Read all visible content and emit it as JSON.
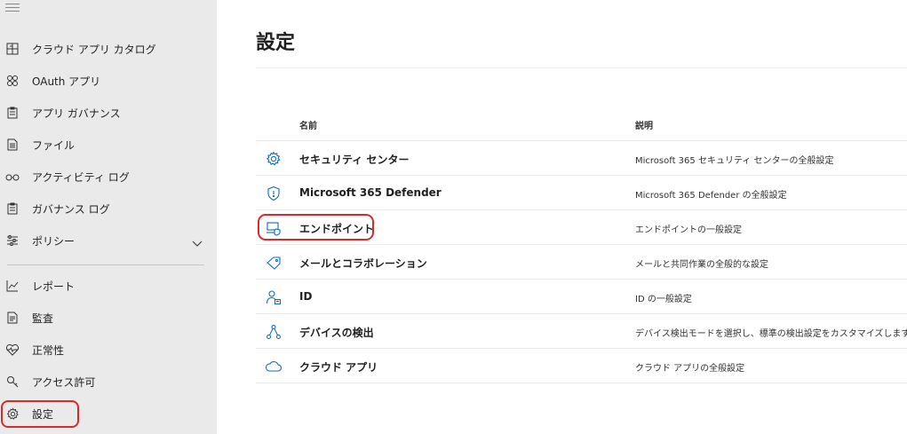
{
  "sidebar": {
    "items": [
      {
        "label": "クラウド アプリ カタログ",
        "icon": "catalog-icon"
      },
      {
        "label": "OAuth アプリ",
        "icon": "oauth-apps-icon"
      },
      {
        "label": "アプリ ガバナンス",
        "icon": "app-governance-icon"
      },
      {
        "label": "ファイル",
        "icon": "files-icon"
      },
      {
        "label": "アクティビティ ログ",
        "icon": "glasses-icon"
      },
      {
        "label": "ガバナンス ログ",
        "icon": "governance-log-icon"
      },
      {
        "label": "ポリシー",
        "icon": "policy-sliders-icon",
        "expandable": true
      },
      {
        "label": "レポート",
        "icon": "report-chart-icon"
      },
      {
        "label": "監査",
        "icon": "audit-icon"
      },
      {
        "label": "正常性",
        "icon": "health-heart-icon"
      },
      {
        "label": "アクセス許可",
        "icon": "key-icon"
      },
      {
        "label": "設定",
        "icon": "gear-icon",
        "highlighted": true
      }
    ]
  },
  "main": {
    "title": "設定",
    "table": {
      "headers": {
        "name": "名前",
        "description": "説明"
      },
      "rows": [
        {
          "name": "セキュリティ センター",
          "description": "Microsoft 365 セキュリティ センターの全般設定",
          "icon": "gear-icon"
        },
        {
          "name": "Microsoft 365 Defender",
          "description": "Microsoft 365 Defender の全般設定",
          "icon": "shield-icon"
        },
        {
          "name": "エンドポイント",
          "description": "エンドポイントの一般設定",
          "icon": "endpoint-device-icon",
          "highlighted": true
        },
        {
          "name": "メールとコラボレーション",
          "description": "メールと共同作業の全般的な設定",
          "icon": "mail-tag-icon"
        },
        {
          "name": "ID",
          "description": "ID の一般設定",
          "icon": "identity-person-icon"
        },
        {
          "name": "デバイスの検出",
          "description": "デバイス検出モードを選択し、標準の検出設定をカスタマイズします",
          "icon": "device-discovery-icon"
        },
        {
          "name": "クラウド アプリ",
          "description": "クラウド アプリの全般設定",
          "icon": "cloud-icon"
        }
      ]
    }
  },
  "colors": {
    "sidebar_bg": "#eaeaea",
    "accent_blue": "#0f6cbd",
    "highlight_red": "#d52b2b"
  }
}
